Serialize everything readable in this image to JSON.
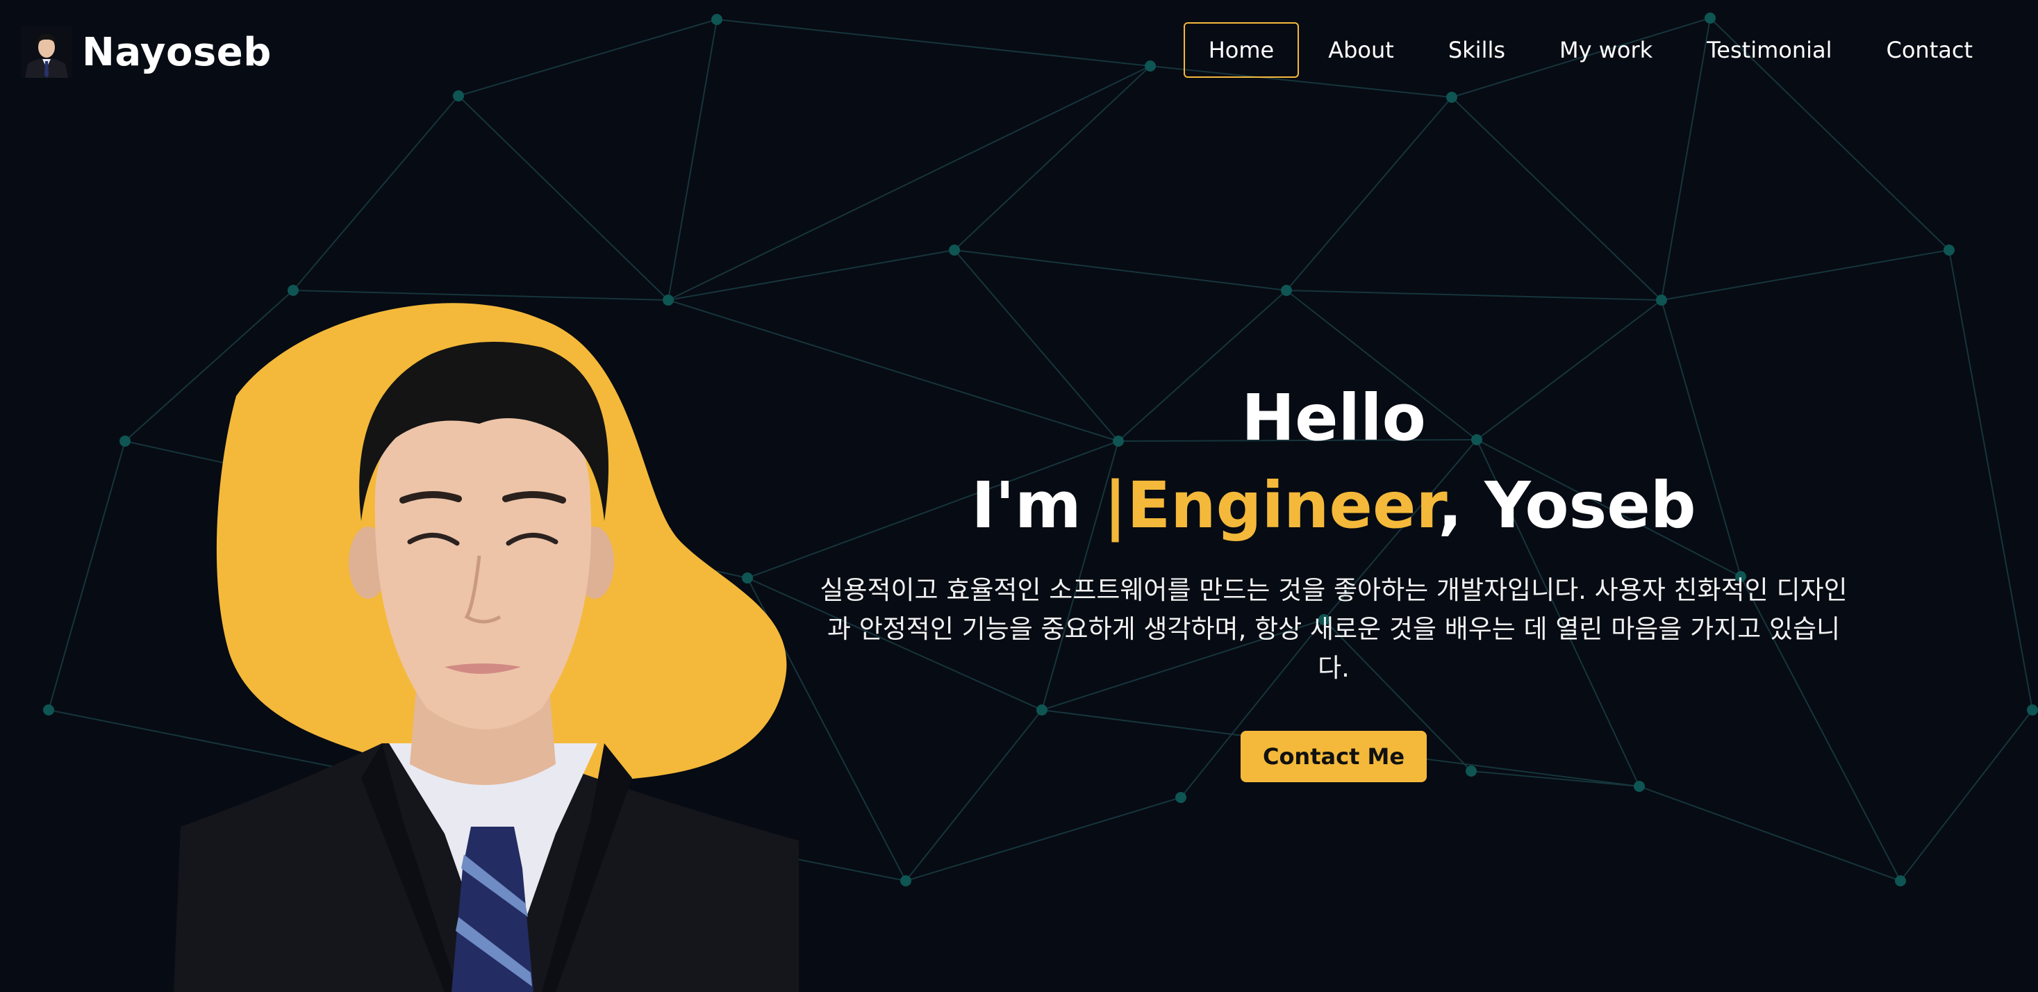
{
  "brand": {
    "name": "Nayoseb",
    "avatar_icon": "profile-avatar-icon"
  },
  "nav": {
    "items": [
      {
        "label": "Home",
        "active": true
      },
      {
        "label": "About",
        "active": false
      },
      {
        "label": "Skills",
        "active": false
      },
      {
        "label": "My work",
        "active": false
      },
      {
        "label": "Testimonial",
        "active": false
      },
      {
        "label": "Contact",
        "active": false
      }
    ]
  },
  "hero": {
    "greeting": "Hello",
    "intro_prefix": "I'm ",
    "role": "|Engineer",
    "intro_suffix": ", Yoseb",
    "description": "실용적이고 효율적인 소프트웨어를 만드는 것을 좋아하는 개발자입니다. 사용자 친화적인 디자인과 안정적인 기능을 중요하게 생각하며, 항상 새로운 것을 배우는 데 열린 마음을 가지고 있습니다.",
    "cta_label": "Contact Me",
    "photo_icon": "profile-portrait-image"
  },
  "colors": {
    "background": "#070b13",
    "accent": "#f4b93a",
    "network_line": "#16353c",
    "network_node": "#0e5553",
    "text": "#ffffff"
  }
}
